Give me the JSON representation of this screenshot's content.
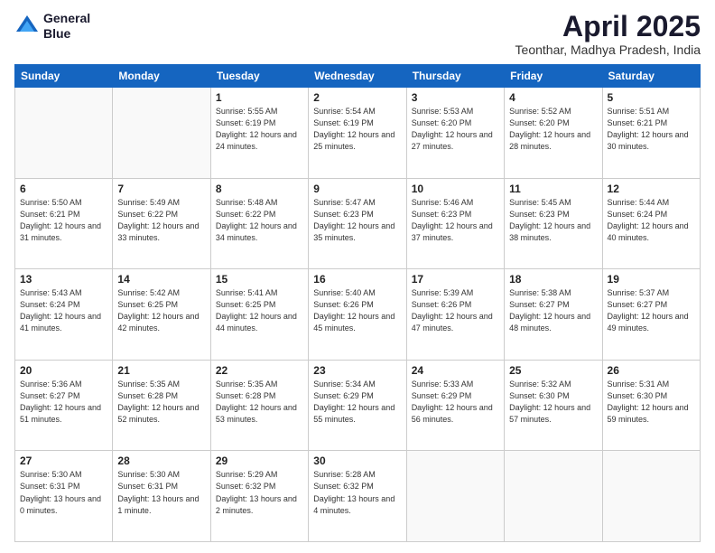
{
  "logo": {
    "line1": "General",
    "line2": "Blue"
  },
  "title": "April 2025",
  "subtitle": "Teonthar, Madhya Pradesh, India",
  "weekdays": [
    "Sunday",
    "Monday",
    "Tuesday",
    "Wednesday",
    "Thursday",
    "Friday",
    "Saturday"
  ],
  "weeks": [
    [
      {
        "day": "",
        "info": ""
      },
      {
        "day": "",
        "info": ""
      },
      {
        "day": "1",
        "info": "Sunrise: 5:55 AM\nSunset: 6:19 PM\nDaylight: 12 hours and 24 minutes."
      },
      {
        "day": "2",
        "info": "Sunrise: 5:54 AM\nSunset: 6:19 PM\nDaylight: 12 hours and 25 minutes."
      },
      {
        "day": "3",
        "info": "Sunrise: 5:53 AM\nSunset: 6:20 PM\nDaylight: 12 hours and 27 minutes."
      },
      {
        "day": "4",
        "info": "Sunrise: 5:52 AM\nSunset: 6:20 PM\nDaylight: 12 hours and 28 minutes."
      },
      {
        "day": "5",
        "info": "Sunrise: 5:51 AM\nSunset: 6:21 PM\nDaylight: 12 hours and 30 minutes."
      }
    ],
    [
      {
        "day": "6",
        "info": "Sunrise: 5:50 AM\nSunset: 6:21 PM\nDaylight: 12 hours and 31 minutes."
      },
      {
        "day": "7",
        "info": "Sunrise: 5:49 AM\nSunset: 6:22 PM\nDaylight: 12 hours and 33 minutes."
      },
      {
        "day": "8",
        "info": "Sunrise: 5:48 AM\nSunset: 6:22 PM\nDaylight: 12 hours and 34 minutes."
      },
      {
        "day": "9",
        "info": "Sunrise: 5:47 AM\nSunset: 6:23 PM\nDaylight: 12 hours and 35 minutes."
      },
      {
        "day": "10",
        "info": "Sunrise: 5:46 AM\nSunset: 6:23 PM\nDaylight: 12 hours and 37 minutes."
      },
      {
        "day": "11",
        "info": "Sunrise: 5:45 AM\nSunset: 6:23 PM\nDaylight: 12 hours and 38 minutes."
      },
      {
        "day": "12",
        "info": "Sunrise: 5:44 AM\nSunset: 6:24 PM\nDaylight: 12 hours and 40 minutes."
      }
    ],
    [
      {
        "day": "13",
        "info": "Sunrise: 5:43 AM\nSunset: 6:24 PM\nDaylight: 12 hours and 41 minutes."
      },
      {
        "day": "14",
        "info": "Sunrise: 5:42 AM\nSunset: 6:25 PM\nDaylight: 12 hours and 42 minutes."
      },
      {
        "day": "15",
        "info": "Sunrise: 5:41 AM\nSunset: 6:25 PM\nDaylight: 12 hours and 44 minutes."
      },
      {
        "day": "16",
        "info": "Sunrise: 5:40 AM\nSunset: 6:26 PM\nDaylight: 12 hours and 45 minutes."
      },
      {
        "day": "17",
        "info": "Sunrise: 5:39 AM\nSunset: 6:26 PM\nDaylight: 12 hours and 47 minutes."
      },
      {
        "day": "18",
        "info": "Sunrise: 5:38 AM\nSunset: 6:27 PM\nDaylight: 12 hours and 48 minutes."
      },
      {
        "day": "19",
        "info": "Sunrise: 5:37 AM\nSunset: 6:27 PM\nDaylight: 12 hours and 49 minutes."
      }
    ],
    [
      {
        "day": "20",
        "info": "Sunrise: 5:36 AM\nSunset: 6:27 PM\nDaylight: 12 hours and 51 minutes."
      },
      {
        "day": "21",
        "info": "Sunrise: 5:35 AM\nSunset: 6:28 PM\nDaylight: 12 hours and 52 minutes."
      },
      {
        "day": "22",
        "info": "Sunrise: 5:35 AM\nSunset: 6:28 PM\nDaylight: 12 hours and 53 minutes."
      },
      {
        "day": "23",
        "info": "Sunrise: 5:34 AM\nSunset: 6:29 PM\nDaylight: 12 hours and 55 minutes."
      },
      {
        "day": "24",
        "info": "Sunrise: 5:33 AM\nSunset: 6:29 PM\nDaylight: 12 hours and 56 minutes."
      },
      {
        "day": "25",
        "info": "Sunrise: 5:32 AM\nSunset: 6:30 PM\nDaylight: 12 hours and 57 minutes."
      },
      {
        "day": "26",
        "info": "Sunrise: 5:31 AM\nSunset: 6:30 PM\nDaylight: 12 hours and 59 minutes."
      }
    ],
    [
      {
        "day": "27",
        "info": "Sunrise: 5:30 AM\nSunset: 6:31 PM\nDaylight: 13 hours and 0 minutes."
      },
      {
        "day": "28",
        "info": "Sunrise: 5:30 AM\nSunset: 6:31 PM\nDaylight: 13 hours and 1 minute."
      },
      {
        "day": "29",
        "info": "Sunrise: 5:29 AM\nSunset: 6:32 PM\nDaylight: 13 hours and 2 minutes."
      },
      {
        "day": "30",
        "info": "Sunrise: 5:28 AM\nSunset: 6:32 PM\nDaylight: 13 hours and 4 minutes."
      },
      {
        "day": "",
        "info": ""
      },
      {
        "day": "",
        "info": ""
      },
      {
        "day": "",
        "info": ""
      }
    ]
  ]
}
